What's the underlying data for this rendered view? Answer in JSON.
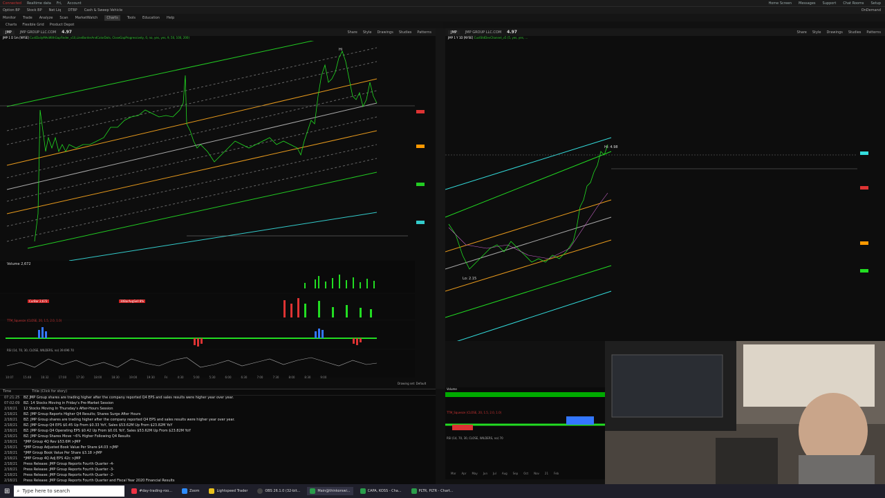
{
  "topbar": {
    "connected": "Connected",
    "realtime": "Realtime data",
    "date": "Fri,",
    "account_label": "Account",
    "right": [
      "Home Screen",
      "Messages",
      "Support",
      "Chat Rooms",
      "Setup"
    ],
    "ondemand": "OnDemand"
  },
  "menu": {
    "items": [
      "Monitor",
      "Trade",
      "Analyze",
      "Scan",
      "MarketWatch",
      "Charts",
      "Tools",
      "Education",
      "Help"
    ],
    "active": "Charts",
    "row2": [
      "Option BP",
      "Stock BP",
      "Net Liq",
      "DTBP",
      "Cash & Sweep Vehicle"
    ]
  },
  "subtabs": [
    "Charts",
    "Flexible Grid",
    "Product Depot"
  ],
  "left_chart": {
    "symbol": "JMP",
    "company": "JMP GROUP LLC.COM",
    "price": "4.97",
    "title_row": "JMP 1 D 1m [NYSE]",
    "study_row": "CustDailyMAsWithGapFinder_v10,LineBorderAndColorDots, CloseGapProgressively, 0, no, yes, yes, 9, 50, 100, 200)",
    "tools": [
      "Share",
      "Style",
      "Drawings",
      "Studies",
      "Patterns"
    ],
    "volume_label": "Volume",
    "volume_value": "2,672",
    "curbar": "CurBar 2,672",
    "avg": "30BarAvgSell 8%",
    "squeeze": "TTM_Squeeze (CLOSE, 20, 1.5, 2.0, 1.0)",
    "rsi": "RSI (14, 70, 30, CLOSE, WILDERS, no)",
    "rsi_value": "39.696",
    "rsi_70": "70",
    "times": [
      "10:07",
      "15:48",
      "16:32",
      "17:00",
      "17:30",
      "18:00",
      "18:30",
      "19:00",
      "19:30",
      "Fri",
      "4:30",
      "5:00",
      "5:30",
      "6:00",
      "6:30",
      "7:00",
      "7:30",
      "8:00",
      "8:30",
      "9:00"
    ],
    "drawing_set": "Drawing set: Default"
  },
  "right_chart": {
    "symbol": "JMP",
    "company": "JMP GROUP LLC.COM",
    "price": "4.97",
    "title_row": "JMP 1 Y 1D [NYSE]",
    "study_row": "CustStdDevChannel_v5 (5, yes, yes, ...",
    "tools": [
      "Share",
      "Style",
      "Drawings",
      "Studies",
      "Patterns"
    ],
    "hi_label": "Hi: 4.98",
    "lo_label": "Lo: 2.15",
    "volume_label": "Volume",
    "squeeze": "TTM_Squeeze (CLOSE, 20, 1.5, 2.0, 1.0)",
    "rsi": "RSI (14, 70, 30, CLOSE, WILDERS, no)",
    "rsi_value": "70",
    "months": [
      "Mar",
      "Apr",
      "May",
      "Jun",
      "Jul",
      "Aug",
      "Sep",
      "Oct",
      "Nov",
      "21",
      "Feb"
    ]
  },
  "news": {
    "time_header": "Time",
    "title_header": "Title (Click for story)",
    "rows": [
      {
        "d": "07:21:25",
        "t": "BZ JMP Group shares are trading higher after the company reported Q4 EPS and sales results were higher year over year."
      },
      {
        "d": "07:02:09",
        "t": "BZ: 14 Stocks Moving in Friday's Pre-Market Session"
      },
      {
        "d": "2/18/21",
        "t": "12 Stocks Moving In Thursday's After-Hours Session"
      },
      {
        "d": "2/18/21",
        "t": "BZ: JMP Group Reports Higher Q4 Results; Shares Surge After Hours"
      },
      {
        "d": "2/18/21",
        "t": "BZ: JMP Group shares are trading higher after the company reported Q4 EPS and sales results were higher year over year."
      },
      {
        "d": "2/18/21",
        "t": "BZ: JMP Group Q4 EPS $0.45 Up From $0.33 YoY, Sales $53.62M Up From $23.82M YoY"
      },
      {
        "d": "2/18/21",
        "t": "BZ: JMP Group Q4 Operating EPS $0.42 Up From $0.01 YoY, Sales $53.62M Up From $23.82M YoY"
      },
      {
        "d": "2/18/21",
        "t": "BZ: JMP Group Shares Move ~6% Higher Following Q4 Results"
      },
      {
        "d": "2/18/21",
        "t": "*JMP Group 4Q Rev $53.6M >JMP"
      },
      {
        "d": "2/18/21",
        "t": "*JMP Group Adjusted Book Value Per Share $4.03 >JMP"
      },
      {
        "d": "2/18/21",
        "t": "*JMP Group Book Value Per Share $3.18 >JMP"
      },
      {
        "d": "2/18/21",
        "t": "*JMP Group 4Q Adj EPS 42c >JMP"
      },
      {
        "d": "2/18/21",
        "t": "Press Release: JMP Group Reports Fourth Quarter -4-"
      },
      {
        "d": "2/18/21",
        "t": "Press Release: JMP Group Reports Fourth Quarter -3-"
      },
      {
        "d": "2/18/21",
        "t": "Press Release: JMP Group Reports Fourth Quarter -2-"
      },
      {
        "d": "2/18/21",
        "t": "Press Release: JMP Group Reports Fourth Quarter and Fiscal Year 2020 Financial Results"
      }
    ]
  },
  "taskbar": {
    "search_placeholder": "Type here to search",
    "tasks": [
      "#day-trading-roo...",
      "Zoom",
      "Lightspeed Trader",
      "OBS 26.1.0 (32-bit...",
      "Main@thinkorswi...",
      "CAPA, KOSS - Cha...",
      "PLTR, PLTR - Chart..."
    ]
  },
  "colors": {
    "green": "#22dd22",
    "orange": "#ff9900",
    "cyan": "#33dddd",
    "red": "#e33333",
    "bg": "#0d0d0d"
  }
}
